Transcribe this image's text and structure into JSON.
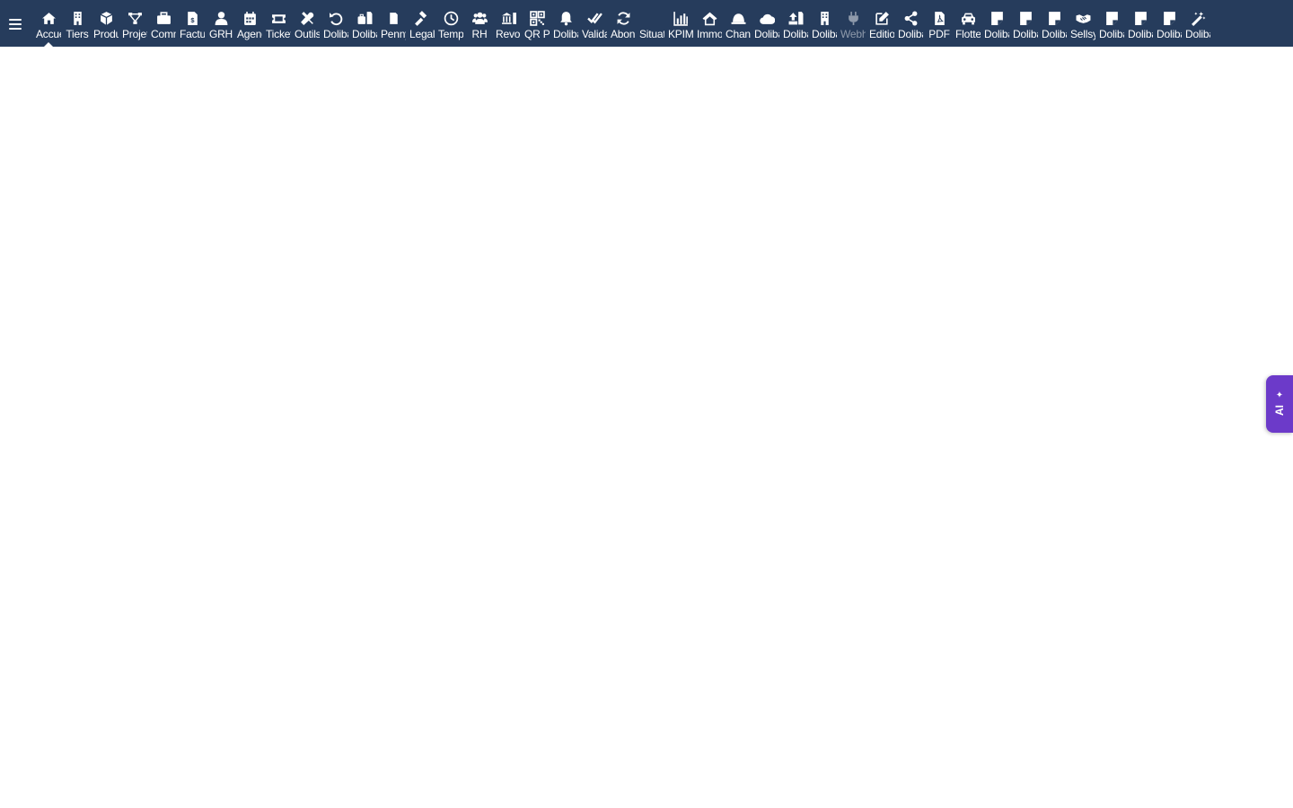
{
  "menu": {
    "items": [
      {
        "label": "Accueil",
        "icon": "home-icon",
        "active": true
      },
      {
        "label": "Tiers",
        "icon": "building-icon"
      },
      {
        "label": "Produits",
        "icon": "cube-icon"
      },
      {
        "label": "Projets",
        "icon": "project-icon"
      },
      {
        "label": "Commerce",
        "icon": "briefcase-icon"
      },
      {
        "label": "Facturation",
        "icon": "invoice-icon"
      },
      {
        "label": "GRH",
        "icon": "user-tie-icon"
      },
      {
        "label": "Agenda",
        "icon": "calendar-icon"
      },
      {
        "label": "Tickets",
        "icon": "ticket-icon"
      },
      {
        "label": "Outils",
        "icon": "tools-icon"
      },
      {
        "label": "Dolibarr",
        "icon": "undo-icon"
      },
      {
        "label": "Dolibarr",
        "icon": "briefcase-file-icon"
      },
      {
        "label": "Pennylane",
        "icon": "file-icon"
      },
      {
        "label": "Legal",
        "icon": "gavel-icon"
      },
      {
        "label": "Temps",
        "icon": "clock-icon"
      },
      {
        "label": "RH",
        "icon": "users-icon"
      },
      {
        "label": "Revolut",
        "icon": "bank-icon"
      },
      {
        "label": "QR Pay",
        "icon": "qrcode-icon"
      },
      {
        "label": "Dolibarr",
        "icon": "bell-icon"
      },
      {
        "label": "Validation",
        "icon": "double-check-icon"
      },
      {
        "label": "Abonnements",
        "icon": "sync-icon"
      },
      {
        "label": "Situation",
        "icon": "situation-icon"
      },
      {
        "label": "KPIMax",
        "icon": "bar-chart-icon"
      },
      {
        "label": "Immobilier",
        "icon": "house-icon"
      },
      {
        "label": "Chantier",
        "icon": "helmet-icon"
      },
      {
        "label": "Dolibarr",
        "icon": "cloud-icon"
      },
      {
        "label": "Dolibarr",
        "icon": "upload-icon"
      },
      {
        "label": "Dolibarr",
        "icon": "building-icon"
      },
      {
        "label": "Webhooks",
        "icon": "plug-icon",
        "disabled": true
      },
      {
        "label": "Edition",
        "icon": "edit-icon"
      },
      {
        "label": "Dolibarr",
        "icon": "share-icon"
      },
      {
        "label": "PDF",
        "icon": "pdf-icon"
      },
      {
        "label": "Flotte",
        "icon": "car-icon"
      },
      {
        "label": "Dolibarr",
        "icon": "note-icon"
      },
      {
        "label": "Dolibarr",
        "icon": "note-icon"
      },
      {
        "label": "Dolibarr",
        "icon": "note-icon"
      },
      {
        "label": "Sellsy",
        "icon": "handshake-icon"
      },
      {
        "label": "Dolibarr",
        "icon": "note-icon"
      },
      {
        "label": "Dolibarr",
        "icon": "note-icon"
      },
      {
        "label": "Dolibarr",
        "icon": "note-icon"
      },
      {
        "label": "Dolibarr",
        "icon": "magic-wand-icon"
      }
    ]
  },
  "ai_tab": {
    "label": "AI",
    "icon": "sparkle-icon"
  },
  "colors": {
    "topbar": "#263c5c",
    "ai_tab": "#6c3ac9"
  }
}
